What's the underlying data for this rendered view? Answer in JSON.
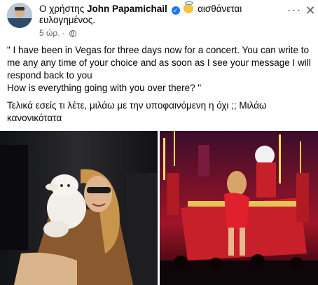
{
  "header": {
    "prefix": "Ο χρήστης",
    "author": "John Papamichail",
    "feeling_line1": "αισθάνεται",
    "feeling_line2": "ευλογημένος.",
    "time": "5 ώρ.",
    "separator": "·",
    "verified_icon": "verified-badge-icon",
    "feeling_icon": "smiling-face-with-halo-icon",
    "privacy_icon": "globe-icon"
  },
  "actions": {
    "more": "···",
    "close": "✕"
  },
  "post": {
    "quote_text": "\"  I have been in Vegas for three days now for a concert. You can write to me any any time of your choice and as soon as I see your message I will respond back to you\nHow is everything going with you over there? \"",
    "comment_text": "Τελικά εσείς τι λέτε,  μιλάω με την υποφαινόμενη  η όχι  ;; Μιλάω κανονικότατα"
  },
  "photos": [
    {
      "name": "photo-woman-with-plush-lamb"
    },
    {
      "name": "photo-christmas-concert-stage"
    }
  ],
  "colors": {
    "text": "#050505",
    "meta": "#65676b",
    "verified": "#1877f2"
  }
}
